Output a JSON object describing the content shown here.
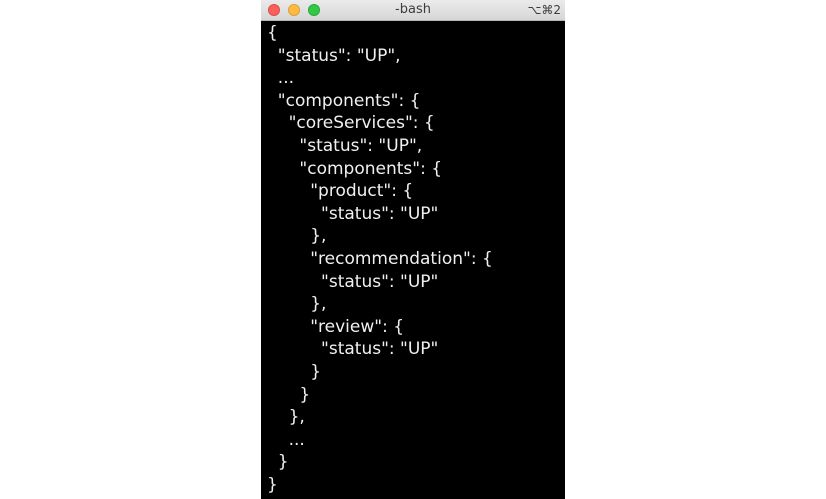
{
  "window": {
    "title": "-bash",
    "shortcut": "⌥⌘2"
  },
  "terminal": {
    "lines": [
      "{",
      "  \"status\": \"UP\",",
      "  ...",
      "  \"components\": {",
      "    \"coreServices\": {",
      "      \"status\": \"UP\",",
      "      \"components\": {",
      "        \"product\": {",
      "          \"status\": \"UP\"",
      "        },",
      "        \"recommendation\": {",
      "          \"status\": \"UP\"",
      "        },",
      "        \"review\": {",
      "          \"status\": \"UP\"",
      "        }",
      "      }",
      "    },",
      "    ...",
      "  }",
      "}"
    ]
  }
}
